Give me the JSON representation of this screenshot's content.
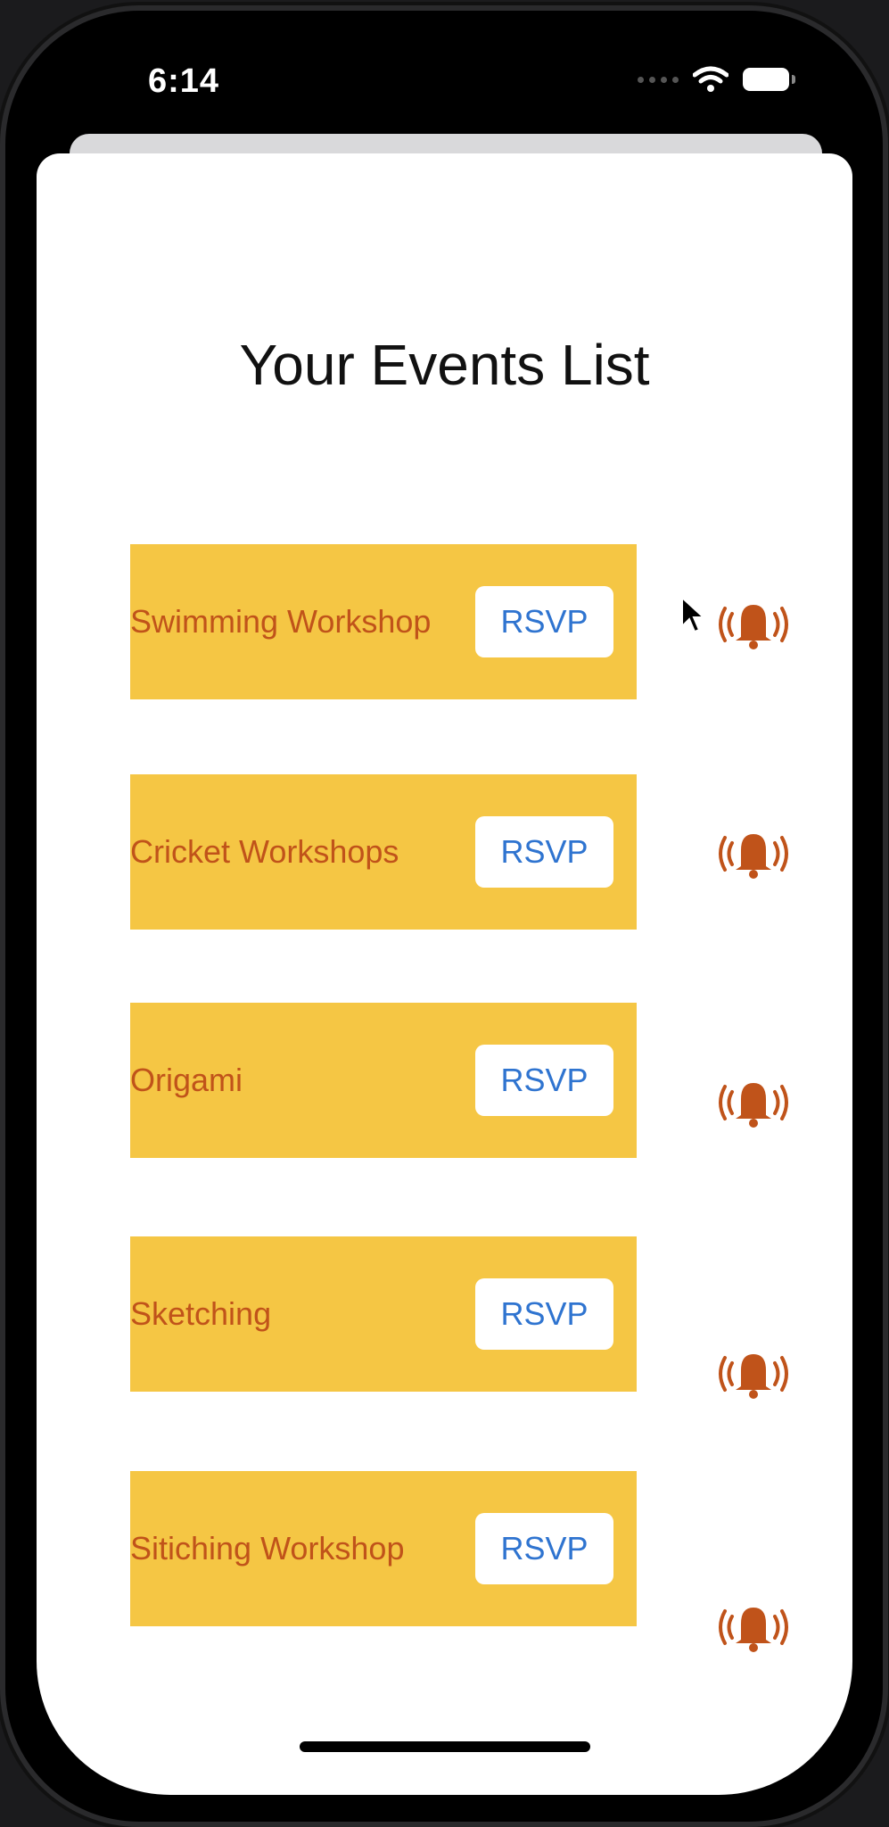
{
  "status_bar": {
    "time": "6:14"
  },
  "page": {
    "title": "Your Events List"
  },
  "events": [
    {
      "name": "Swimming Workshop",
      "button_label": "RSVP",
      "icon": "alarm-bell-icon"
    },
    {
      "name": "Cricket Workshops",
      "button_label": "RSVP",
      "icon": "alarm-bell-icon"
    },
    {
      "name": "Origami",
      "button_label": "RSVP",
      "icon": "alarm-bell-icon"
    },
    {
      "name": "Sketching",
      "button_label": "RSVP",
      "icon": "alarm-bell-icon"
    },
    {
      "name": "Sitiching Workshop",
      "button_label": "RSVP",
      "icon": "alarm-bell-icon"
    }
  ],
  "colors": {
    "card_background": "#f5c644",
    "event_text": "#c0531a",
    "button_text": "#2f74d0",
    "bell": "#c0531a"
  }
}
